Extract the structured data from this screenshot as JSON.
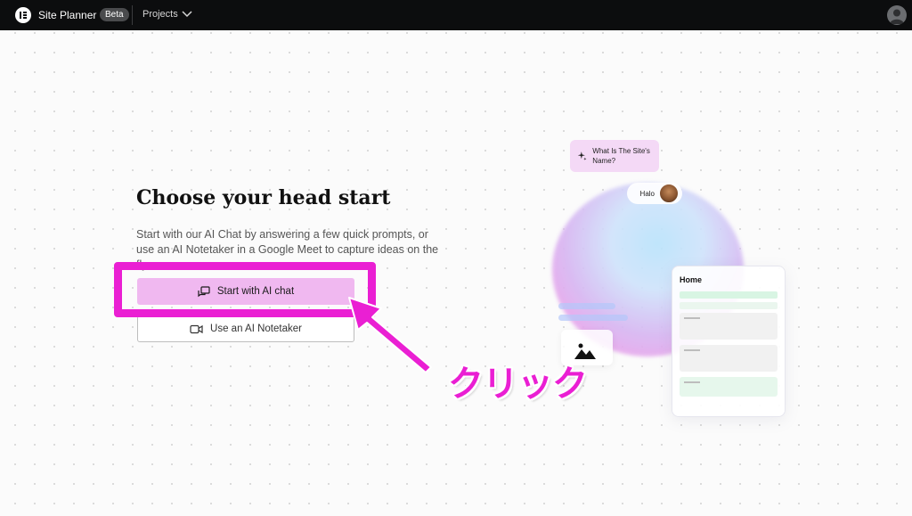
{
  "topbar": {
    "app_title": "Site Planner",
    "badge": "Beta",
    "projects_label": "Projects"
  },
  "main": {
    "headline": "Choose your head start",
    "subtext": "Start with our AI Chat by answering a few quick prompts, or use an AI Notetaker in a Google Meet to capture ideas on the fly.",
    "primary_button": "Start with AI chat",
    "secondary_button": "Use an AI Notetaker"
  },
  "annotation": {
    "text": "クリック",
    "color": "#ea1fd3"
  },
  "illustration": {
    "chat_question": "What Is The Site's Name?",
    "reply_name": "Halo",
    "home_card_title": "Home"
  },
  "colors": {
    "topbar_bg": "#0c0d0e",
    "primary_button_bg": "#f0b8f0",
    "accent": "#ea1fd3"
  }
}
